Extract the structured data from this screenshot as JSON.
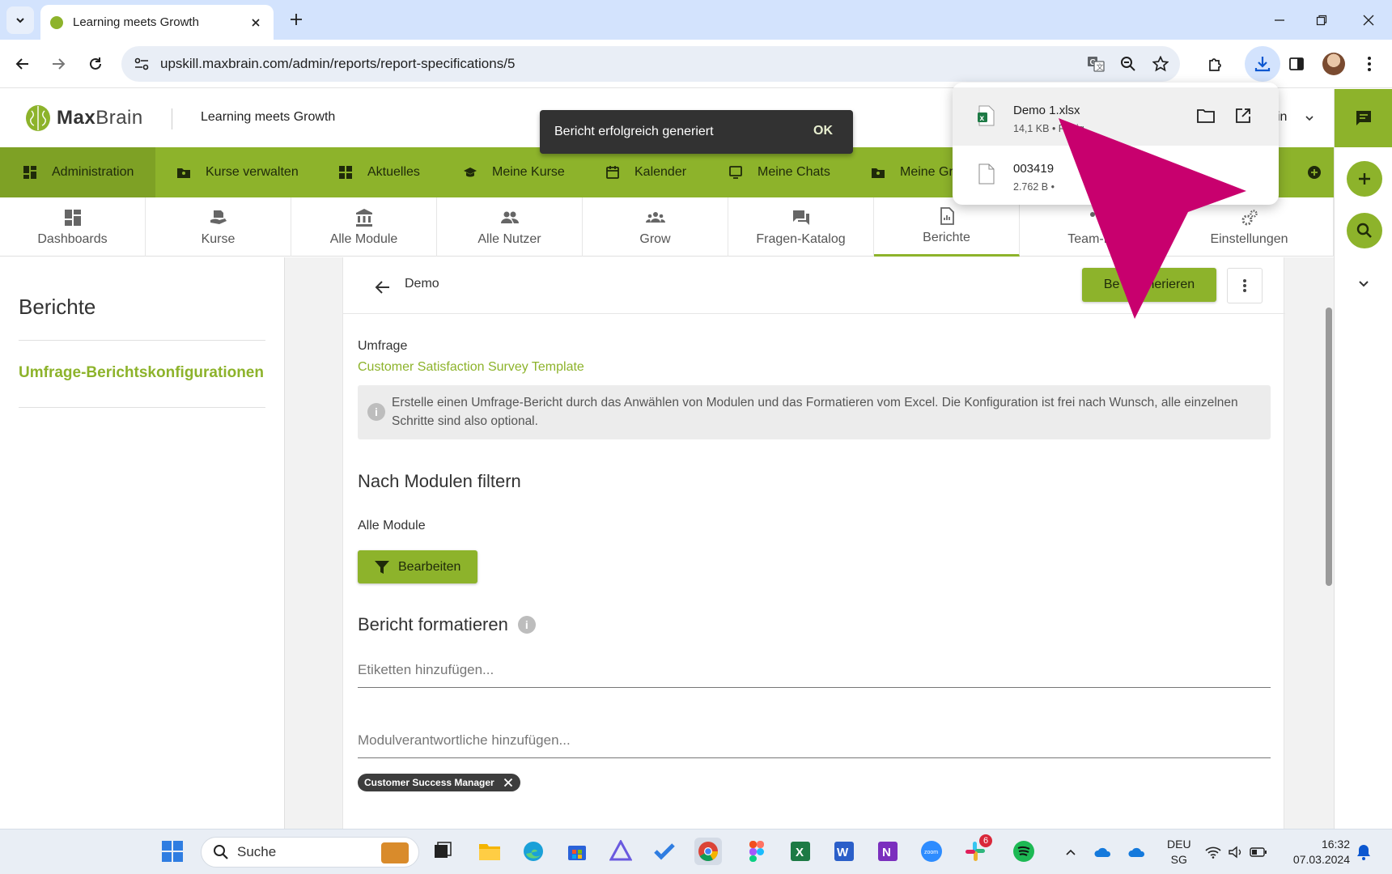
{
  "browser": {
    "tab_title": "Learning meets Growth",
    "url": "upskill.maxbrain.com/admin/reports/report-specifications/5"
  },
  "app": {
    "logo_text_bold": "Max",
    "logo_text_rest": "Brain",
    "tagline": "Learning meets Growth",
    "user_fragment": "in"
  },
  "nav": {
    "items": [
      {
        "label": "Administration",
        "icon": "dashboard-icon"
      },
      {
        "label": "Kurse verwalten",
        "icon": "folder-person-icon"
      },
      {
        "label": "Aktuelles",
        "icon": "grid-icon"
      },
      {
        "label": "Meine Kurse",
        "icon": "graduation-cap-icon"
      },
      {
        "label": "Kalender",
        "icon": "calendar-icon"
      },
      {
        "label": "Meine Chats",
        "icon": "chat-screen-icon"
      },
      {
        "label": "Meine Gru",
        "icon": "folder-group-icon"
      }
    ]
  },
  "subnav": {
    "items": [
      {
        "label": "Dashboards",
        "icon": "dashboard-icon"
      },
      {
        "label": "Kurse",
        "icon": "hand-book-icon"
      },
      {
        "label": "Alle Module",
        "icon": "institution-icon"
      },
      {
        "label": "Alle Nutzer",
        "icon": "people-icon"
      },
      {
        "label": "Grow",
        "icon": "groups-icon"
      },
      {
        "label": "Fragen-Katalog",
        "icon": "forum-icon"
      },
      {
        "label": "Berichte",
        "icon": "report-icon"
      },
      {
        "label": "Team-Er",
        "icon": "team-icon"
      },
      {
        "label": "Einstellungen",
        "icon": "gears-icon"
      }
    ],
    "active_index": 6
  },
  "sidebar": {
    "title": "Berichte",
    "link": "Umfrage-Berichtskonfigurationen"
  },
  "report": {
    "title": "Demo",
    "generate_label_a": "Be",
    "generate_label_b": "nerieren",
    "survey_label": "Umfrage",
    "survey_name": "Customer Satisfaction Survey Template",
    "info_text": "Erstelle einen Umfrage-Bericht durch das Anwählen von Modulen und das Formatieren vom Excel. Die Konfiguration ist frei nach Wunsch, alle einzelnen Schritte sind also optional.",
    "filter_heading": "Nach Modulen filtern",
    "modules_label": "Alle Module",
    "edit_button": "Bearbeiten",
    "format_heading": "Bericht formatieren",
    "tags_placeholder": "Etiketten hinzufügen...",
    "owners_placeholder": "Modulverantwortliche hinzufügen...",
    "chip_label": "Customer Success Manager"
  },
  "snackbar": {
    "message": "Bericht erfolgreich generiert",
    "action": "OK"
  },
  "downloads": [
    {
      "name": "Demo 1.xlsx",
      "meta": "14,1 KB • Fertig",
      "type": "excel"
    },
    {
      "name": "003419",
      "meta": "2.762 B • ",
      "type": "generic"
    }
  ],
  "taskbar": {
    "search_label": "Suche",
    "lang_line1": "DEU",
    "lang_line2": "SG",
    "time": "16:32",
    "date": "07.03.2024",
    "slack_badge": "6"
  },
  "colors": {
    "brand_green": "#8db32b",
    "annotation_magenta": "#c8006e",
    "chrome_blue": "#d3e3fd"
  }
}
